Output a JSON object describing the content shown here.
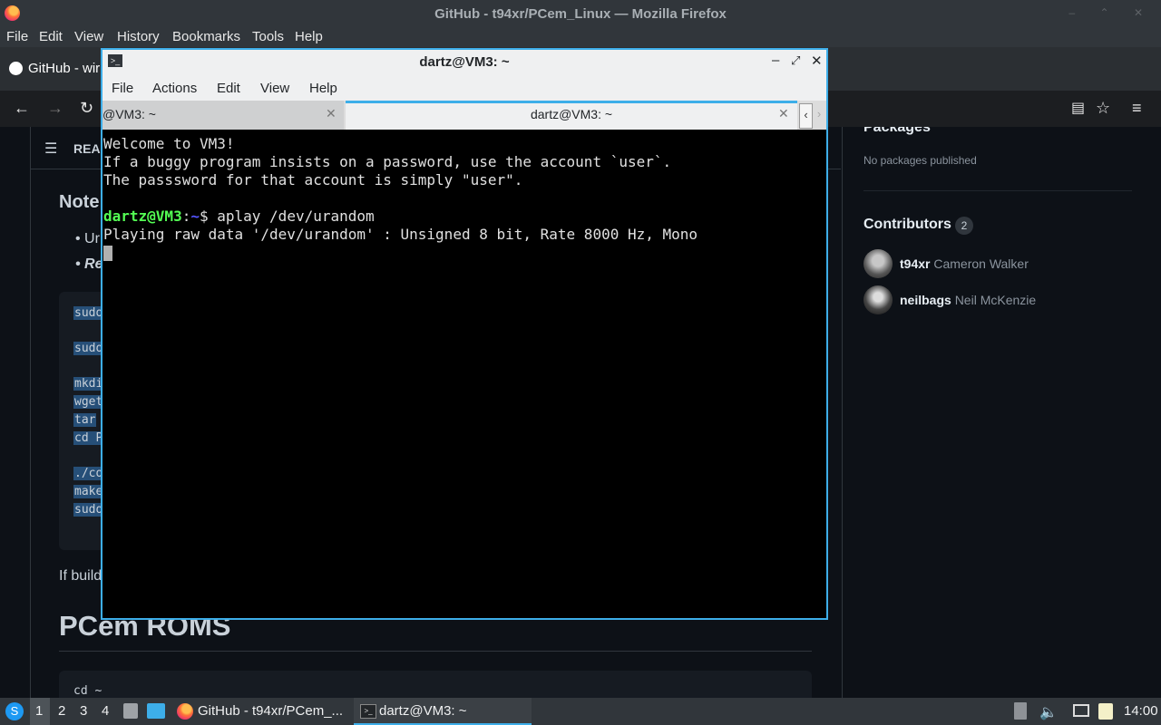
{
  "firefox": {
    "window_title": "GitHub - t94xr/PCem_Linux — Mozilla Firefox",
    "menu": [
      "File",
      "Edit",
      "View",
      "History",
      "Bookmarks",
      "Tools",
      "Help"
    ],
    "tab_label": "GitHub - wir"
  },
  "page": {
    "readme_label": "REA",
    "notes_heading": "Note",
    "bullet1": "Ur",
    "bullet2": "Re",
    "code_prefixes": [
      "sudo",
      "sudo",
      "mkdi",
      "wget",
      "tar ",
      "cd P",
      "./co",
      "make",
      "sudo"
    ],
    "if_text": "If build",
    "roms_heading": "PCem ROMS",
    "roms_code": "cd ~",
    "packages_heading": "Packages",
    "packages_text": "No packages published",
    "contributors_heading": "Contributors",
    "contributors_count": "2",
    "contributors": [
      {
        "login": "t94xr",
        "name": "Cameron Walker"
      },
      {
        "login": "neilbags",
        "name": "Neil McKenzie"
      }
    ]
  },
  "terminal": {
    "title": "dartz@VM3: ~",
    "menu": [
      "File",
      "Actions",
      "Edit",
      "View",
      "Help"
    ],
    "tabs": [
      {
        "label": "@VM3: ~"
      },
      {
        "label": "dartz@VM3: ~"
      }
    ],
    "lines": {
      "l1": "Welcome to VM3!",
      "l2": "If a buggy program insists on a password, use the account `user`.",
      "l3": "The passsword for that account is simply \"user\".",
      "prompt_user": "dartz@VM3",
      "prompt_sep": ":",
      "prompt_path": "~",
      "prompt_sym": "$ ",
      "command": "aplay /dev/urandom",
      "output": "Playing raw data '/dev/urandom' : Unsigned 8 bit, Rate 8000 Hz, Mono"
    },
    "colors": {
      "prompt_user": "#54ff54",
      "prompt_path": "#5454ff",
      "accent": "#3daee9"
    }
  },
  "taskbar": {
    "desktops": [
      "1",
      "2",
      "3",
      "4"
    ],
    "task_firefox": "GitHub - t94xr/PCem_...",
    "task_terminal": "dartz@VM3: ~",
    "clock": "14:00"
  }
}
